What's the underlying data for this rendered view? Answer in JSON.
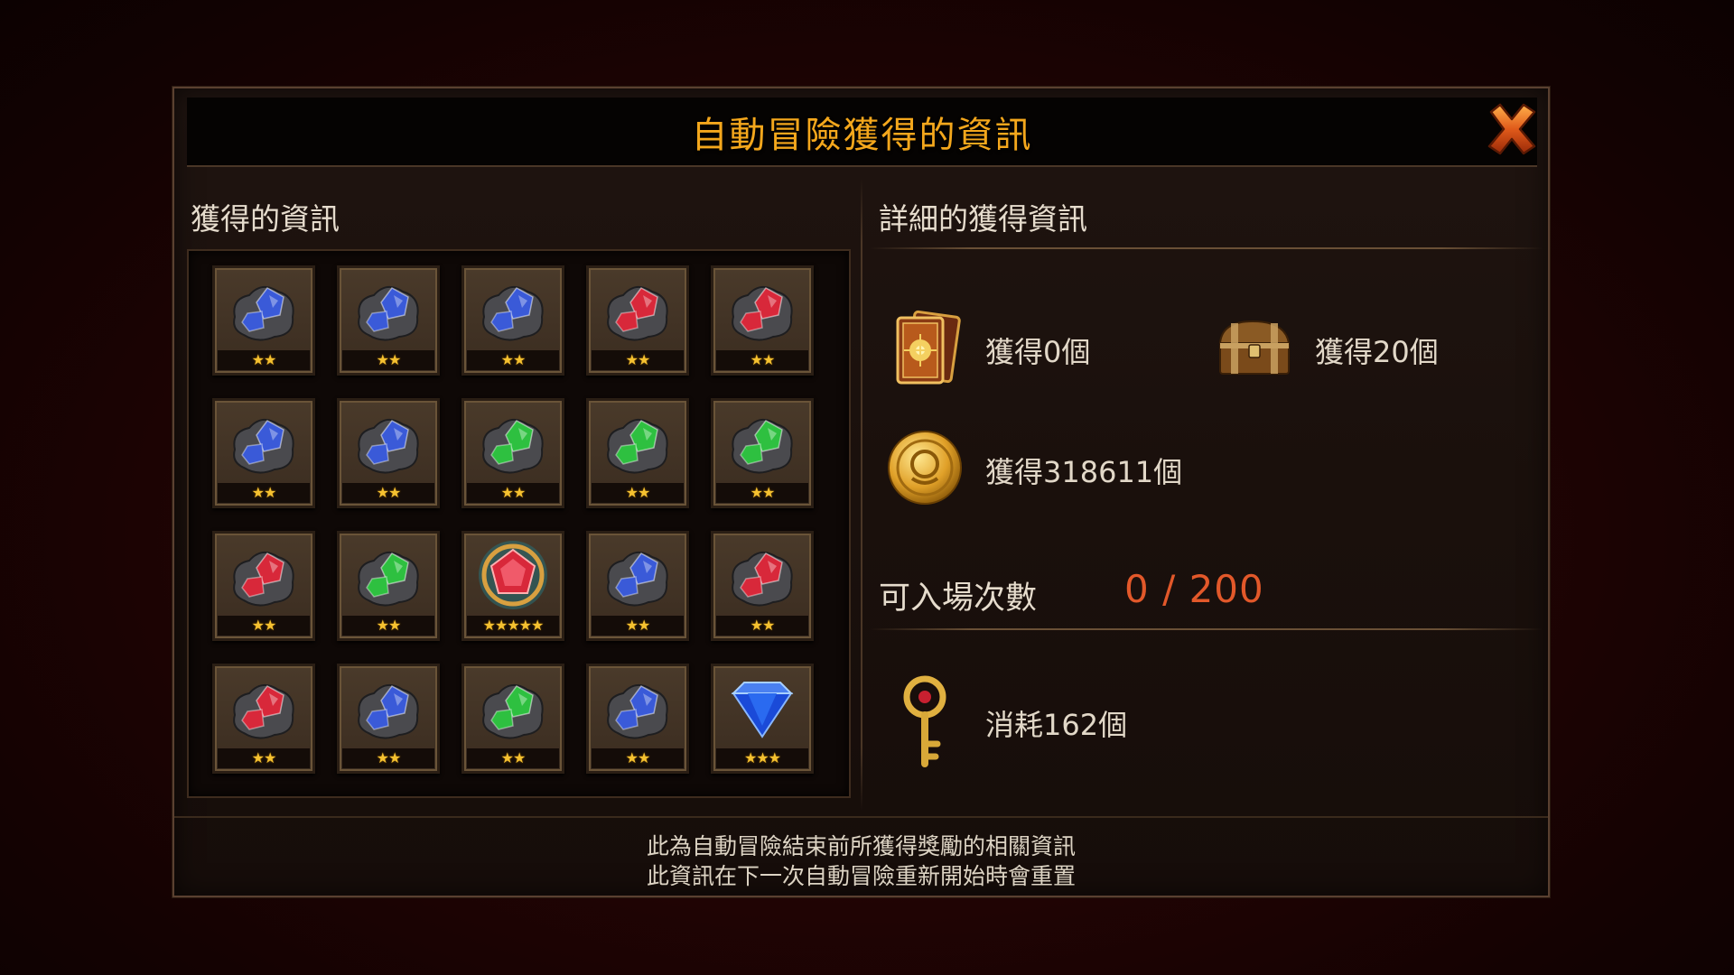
{
  "dialog": {
    "title": "自動冒險獲得的資訊",
    "close_icon": "close-x-icon"
  },
  "left_panel": {
    "header": "獲得的資訊",
    "items": [
      {
        "gem": "blue-ore-icon",
        "stars": "★★"
      },
      {
        "gem": "blue-ore-icon",
        "stars": "★★"
      },
      {
        "gem": "blue-ore-icon",
        "stars": "★★"
      },
      {
        "gem": "red-ore-icon",
        "stars": "★★"
      },
      {
        "gem": "red-ore-icon",
        "stars": "★★"
      },
      {
        "gem": "blue-ore-icon",
        "stars": "★★"
      },
      {
        "gem": "blue-ore-icon",
        "stars": "★★"
      },
      {
        "gem": "green-ore-icon",
        "stars": "★★"
      },
      {
        "gem": "green-ore-icon",
        "stars": "★★"
      },
      {
        "gem": "green-ore-icon",
        "stars": "★★"
      },
      {
        "gem": "red-ore-icon",
        "stars": "★★"
      },
      {
        "gem": "green-ore-icon",
        "stars": "★★"
      },
      {
        "gem": "red-jewel-emblem-icon",
        "stars": "★★★★★"
      },
      {
        "gem": "blue-ore-icon",
        "stars": "★★"
      },
      {
        "gem": "red-ore-icon",
        "stars": "★★"
      },
      {
        "gem": "red-ore-icon",
        "stars": "★★"
      },
      {
        "gem": "blue-ore-icon",
        "stars": "★★"
      },
      {
        "gem": "green-ore-icon",
        "stars": "★★"
      },
      {
        "gem": "blue-ore-icon",
        "stars": "★★"
      },
      {
        "gem": "blue-cut-gem-icon",
        "stars": "★★★"
      }
    ]
  },
  "right_panel": {
    "header": "詳細的獲得資訊",
    "rewards": {
      "cards": {
        "icon": "card-icon",
        "text": "獲得0個"
      },
      "chest": {
        "icon": "treasure-chest-icon",
        "text": "獲得20個"
      },
      "gold": {
        "icon": "gold-coin-icon",
        "text": "獲得318611個"
      }
    },
    "entry_label": "可入場次數",
    "entry_value": "0 / 200",
    "key": {
      "icon": "key-icon",
      "text": "消耗162個"
    }
  },
  "footer": {
    "line1": "此為自動冒險結束前所獲得獎勵的相關資訊",
    "line2": "此資訊在下一次自動冒險重新開始時會重置"
  },
  "colors": {
    "title": "#f4a71c",
    "entry_value": "#e2582a",
    "star": "#f5c130",
    "blue_gem": "#3a5ad8",
    "red_gem": "#d8283a",
    "green_gem": "#2ec040"
  }
}
